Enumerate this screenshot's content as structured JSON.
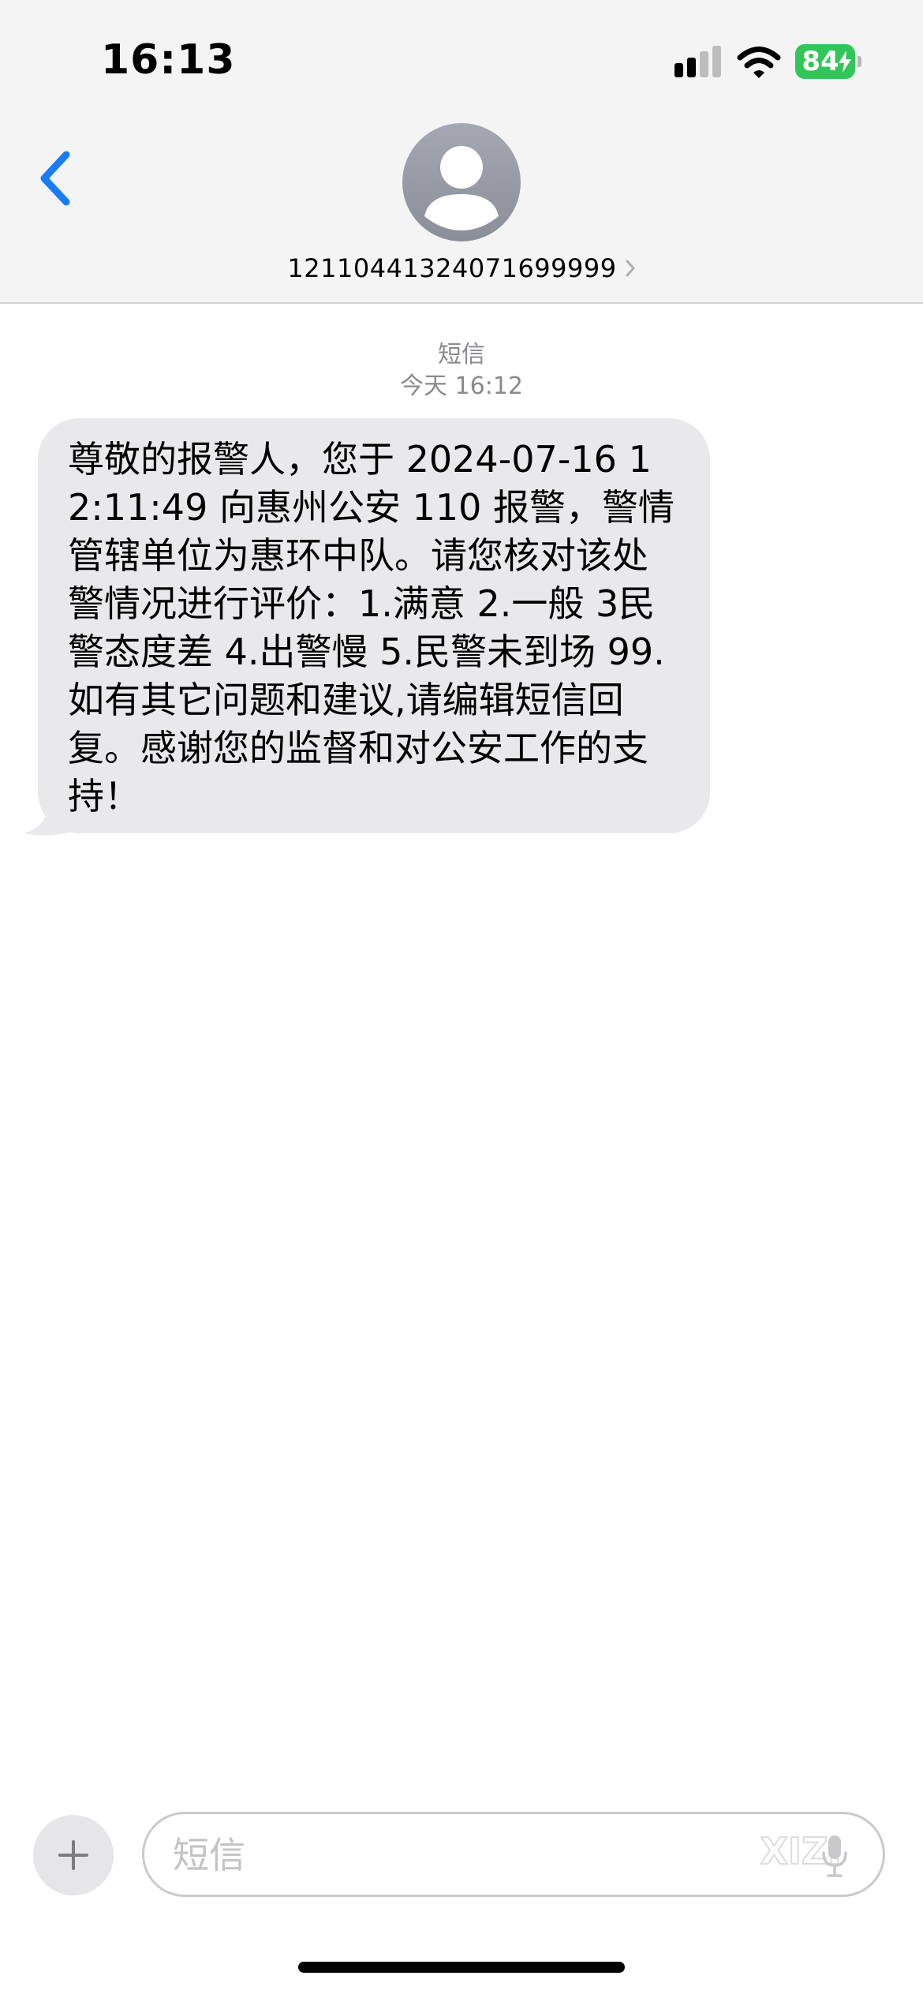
{
  "status_bar": {
    "time": "16:13",
    "battery_level": "84"
  },
  "nav": {
    "back_icon": "chevron-left-icon",
    "avatar_icon": "person-silhouette-icon",
    "contact_number": "12110441324071699999",
    "contact_chevron_icon": "chevron-right-icon"
  },
  "conversation": {
    "label": "短信",
    "timestamp": "今天 16:12",
    "messages": [
      {
        "direction": "incoming",
        "text": "尊敬的报警人，您于 2024-07-16 12:11:49 向惠州公安 110 报警，警情管辖单位为惠环中队。请您核对该处警情况进行评价：1.满意 2.一般 3民警态度差 4.出警慢 5.民警未到场 99.如有其它问题和建议,请编辑短信回复。感谢您的监督和对公安工作的支持！"
      }
    ]
  },
  "composer": {
    "add_icon": "plus-icon",
    "placeholder": "短信",
    "mic_icon": "microphone-icon",
    "watermark": "XIZI"
  },
  "colors": {
    "header_bg": "#f4f4f4",
    "accent_blue": "#1a7cf5",
    "incoming_bubble": "#e9e9eb",
    "battery_green": "#32c659",
    "secondary_text": "#8a8a8e"
  }
}
